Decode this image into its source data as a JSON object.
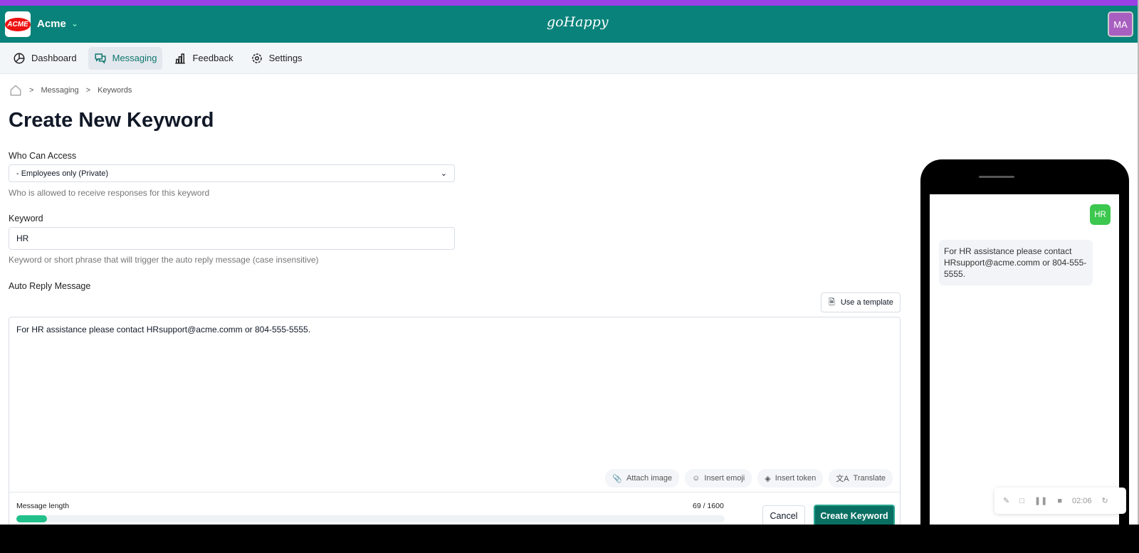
{
  "header": {
    "org_logo_text": "ACME",
    "org_name": "Acme",
    "brand_logo_text": "goHappy",
    "avatar_initials": "MA",
    "accent": "#08827a",
    "stripe": "#9b3fe6"
  },
  "nav": [
    {
      "label": "Dashboard",
      "icon": "pie-chart-icon"
    },
    {
      "label": "Messaging",
      "icon": "chat-icon",
      "active": true
    },
    {
      "label": "Feedback",
      "icon": "bar-chart-icon"
    },
    {
      "label": "Settings",
      "icon": "gear-icon"
    }
  ],
  "breadcrumb": [
    "Messaging",
    "Keywords"
  ],
  "page_title": "Create New Keyword",
  "form": {
    "access_label": "Who Can Access",
    "access_value": "- Employees only (Private)",
    "access_help": "Who is allowed to receive responses for this keyword",
    "keyword_label": "Keyword",
    "keyword_value": "HR",
    "keyword_help": "Keyword or short phrase that will trigger the auto reply message (case insensitive)",
    "reply_label": "Auto Reply Message",
    "template_button": "Use a template",
    "reply_value": "For HR assistance please contact HRsupport@acme.comm or 804-555-5555.",
    "tools": [
      "Attach image",
      "Insert emoji",
      "Insert token",
      "Translate"
    ],
    "length_label": "Message length",
    "length_count": "69 / 1600",
    "length_fraction": 0.043,
    "cancel": "Cancel",
    "submit": "Create Keyword"
  },
  "preview": {
    "sent": "HR",
    "reply": "For HR assistance please contact HRsupport@acme.comm or 804-555-5555."
  },
  "recorder": {
    "time": "02:06"
  }
}
